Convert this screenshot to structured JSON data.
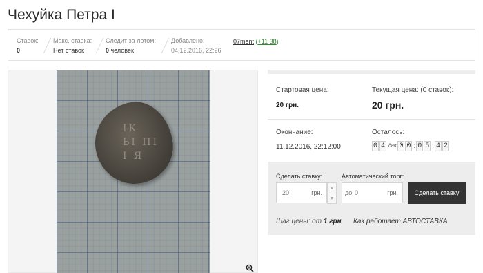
{
  "lot": {
    "title": "Чехуйка Петра I"
  },
  "stats": {
    "bids_label": "Ставок:",
    "bids_value": "0",
    "max_bid_label": "Макс. ставка:",
    "max_bid_value": "Нет ставок",
    "watchers_label": "Следит за лотом:",
    "watchers_count": "0",
    "watchers_unit": " человек",
    "added_label": "Добавлено:",
    "added_value": "04.12.2016, 22:26",
    "seller_name": "07ment",
    "seller_rating": "+11 38"
  },
  "photo": {
    "zoom_icon": "zoom-icon",
    "marks": "IК\nЬI ПI\nI Я"
  },
  "pricing": {
    "start_label": "Стартовая цена:",
    "start_value": "20 грн.",
    "current_label": "Текущая цена: (0 ставок):",
    "current_value": "20 грн.",
    "end_label": "Окончание:",
    "end_value": "11.12.2016, 22:12:00",
    "remaining_label": "Осталось:",
    "timer": {
      "d1": "0",
      "d2": "4",
      "days_word": "дня",
      "h1": "0",
      "h2": "0",
      "m1": "0",
      "m2": "5",
      "s1": "4",
      "s2": "2"
    }
  },
  "bid": {
    "make_bid_label": "Сделать ставку:",
    "bid_placeholder": "20",
    "unit": "грн.",
    "auto_label": "Автоматический торг:",
    "auto_prefix": "до",
    "auto_placeholder": "0",
    "submit_label": "Сделать ставку",
    "step_label": "Шаг цены:",
    "step_pre": " от ",
    "step_value": "1 грн",
    "autobid_link": "Как работает АВТОСТАВКА"
  },
  "colors": {
    "rating_green": "#2e8b2e",
    "button_dark": "#333333",
    "panel_grey": "#ededed"
  }
}
